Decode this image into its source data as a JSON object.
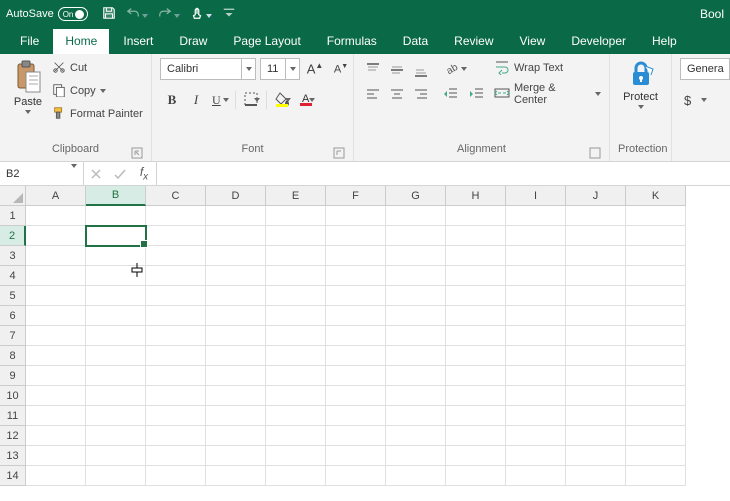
{
  "titlebar": {
    "autosave_label": "AutoSave",
    "autosave_state": "On",
    "doc_name": "Bool"
  },
  "tabs": [
    "File",
    "Home",
    "Insert",
    "Draw",
    "Page Layout",
    "Formulas",
    "Data",
    "Review",
    "View",
    "Developer",
    "Help"
  ],
  "active_tab": "Home",
  "clipboard": {
    "paste": "Paste",
    "cut": "Cut",
    "copy": "Copy",
    "format_painter": "Format Painter",
    "group_label": "Clipboard"
  },
  "font": {
    "name": "Calibri",
    "size": "11",
    "group_label": "Font"
  },
  "alignment": {
    "wrap": "Wrap Text",
    "merge": "Merge & Center",
    "group_label": "Alignment"
  },
  "protection": {
    "protect": "Protect",
    "group_label": "Protection"
  },
  "number": {
    "format": "Genera"
  },
  "namebox": "B2",
  "columns": [
    "A",
    "B",
    "C",
    "D",
    "E",
    "F",
    "G",
    "H",
    "I",
    "J",
    "K"
  ],
  "rows": [
    "1",
    "2",
    "3",
    "4",
    "5",
    "6",
    "7",
    "8",
    "9",
    "10",
    "11",
    "12",
    "13",
    "14"
  ],
  "selected": {
    "col": "B",
    "row": "2"
  },
  "colors": {
    "brand": "#0a6a47",
    "accent": "#217346"
  }
}
